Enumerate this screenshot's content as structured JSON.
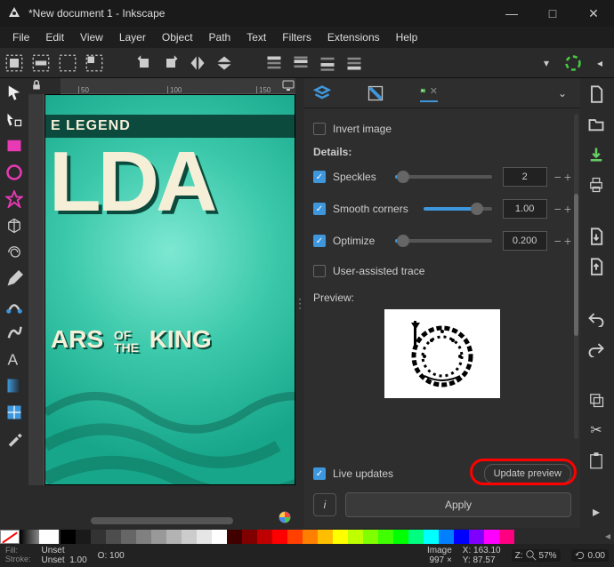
{
  "window": {
    "title": "*New document 1 - Inkscape"
  },
  "menu": {
    "items": [
      "File",
      "Edit",
      "View",
      "Layer",
      "Object",
      "Path",
      "Text",
      "Filters",
      "Extensions",
      "Help"
    ]
  },
  "ruler": {
    "h_ticks": [
      "50",
      "100",
      "150"
    ]
  },
  "poster": {
    "band": "E LEGEND",
    "big": "LDA",
    "sub_left": "ARS",
    "sub_of": "OF\nTHE",
    "sub_right": "KING"
  },
  "trace": {
    "invert": {
      "label": "Invert image",
      "checked": false
    },
    "details_label": "Details:",
    "speckles": {
      "label": "Speckles",
      "checked": true,
      "value": "2",
      "pos": 8
    },
    "smooth": {
      "label": "Smooth corners",
      "checked": true,
      "value": "1.00",
      "pos": 78
    },
    "optimize": {
      "label": "Optimize",
      "checked": true,
      "value": "0.200",
      "pos": 8
    },
    "user_assisted": {
      "label": "User-assisted trace",
      "checked": false
    },
    "preview_label": "Preview:",
    "live": {
      "label": "Live updates",
      "checked": true
    },
    "update_btn": "Update preview",
    "apply_btn": "Apply"
  },
  "status": {
    "fill_label": "Fill:",
    "fill_value": "Unset",
    "stroke_label": "Stroke:",
    "stroke_value": "Unset",
    "stroke_width": "1.00",
    "opacity_label": "O:",
    "opacity_value": "100",
    "image_label": "Image",
    "image_w": "997 ×",
    "image_h": "",
    "x_label": "X:",
    "x_value": "163.10",
    "y_label": "Y:",
    "y_value": "87.57",
    "z_label": "Z:",
    "z_value": "57%",
    "r_value": "0.00"
  },
  "palette": [
    "#000000",
    "#1a1a1a",
    "#333333",
    "#4d4d4d",
    "#666666",
    "#808080",
    "#999999",
    "#b3b3b3",
    "#cccccc",
    "#e6e6e6",
    "#ffffff",
    "#400000",
    "#800000",
    "#bf0000",
    "#ff0000",
    "#ff4000",
    "#ff8000",
    "#ffbf00",
    "#ffff00",
    "#bfff00",
    "#80ff00",
    "#40ff00",
    "#00ff00",
    "#00ff80",
    "#00ffff",
    "#0080ff",
    "#0000ff",
    "#8000ff",
    "#ff00ff",
    "#ff0080"
  ]
}
